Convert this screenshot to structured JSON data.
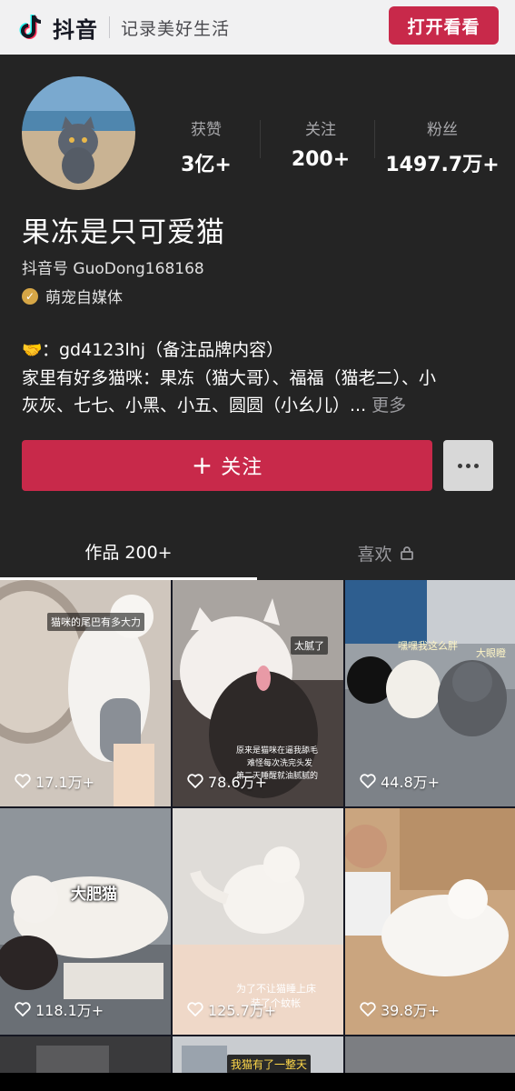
{
  "topbar": {
    "app_name": "抖音",
    "slogan": "记录美好生活",
    "open_button": "打开看看"
  },
  "profile": {
    "stats": [
      {
        "label": "获赞",
        "value": "3亿+"
      },
      {
        "label": "关注",
        "value": "200+"
      },
      {
        "label": "粉丝",
        "value": "1497.7万+"
      }
    ],
    "nickname": "果冻是只可爱猫",
    "douyin_id": "抖音号 GuoDong168168",
    "verification": "萌宠自媒体",
    "bio": {
      "line1": "：gd4123lhj（备注品牌内容）",
      "line2": "家里有好多猫咪：果冻（猫大哥）、福福（猫老二）、小",
      "line3": "灰灰、七七、小黑、小五、圆圆（小幺儿）...",
      "more": "更多"
    },
    "follow_button": "关注",
    "tabs": {
      "works": "作品 200+",
      "likes": "喜欢"
    }
  },
  "videos": [
    {
      "likes": "17.1万+",
      "caption": "猫咪的尾巴有多大力"
    },
    {
      "likes": "78.6万+",
      "caption": "太腻了",
      "caption2": "原来是猫咪在逼我舔毛",
      "caption3": "难怪每次洗完头发",
      "caption4": "第二天睡醒就油腻腻的"
    },
    {
      "likes": "44.8万+",
      "caption": "嘿嘿我这么胖",
      "caption2": "大眼瞪"
    },
    {
      "likes": "118.1万+",
      "caption": "大肥猫"
    },
    {
      "likes": "125.7万+",
      "caption": "为了不让猫睡上床",
      "caption2": "装了个蚊帐"
    },
    {
      "likes": "39.8万+"
    },
    {
      "caption": "我猫有了一整天"
    }
  ],
  "colors": {
    "brand_red": "#c8294a",
    "profile_bg": "#242424",
    "topbar_bg": "#f1f1f2"
  }
}
